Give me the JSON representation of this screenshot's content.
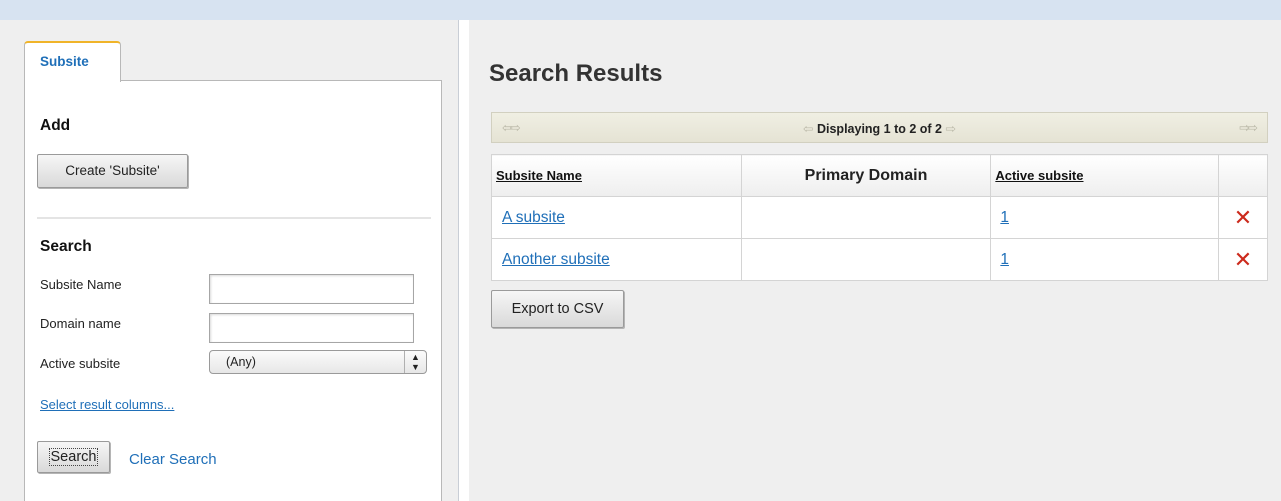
{
  "left": {
    "tab_label": "Subsite",
    "add_title": "Add",
    "create_button": "Create 'Subsite'",
    "search_title": "Search",
    "fields": [
      {
        "label": "Subsite Name",
        "value": ""
      },
      {
        "label": "Domain name",
        "value": ""
      },
      {
        "label": "Active subsite",
        "value": "(Any)"
      }
    ],
    "select_columns_link": "Select result columns...",
    "search_button": "Search",
    "clear_search_link": "Clear Search"
  },
  "results": {
    "title": "Search Results",
    "pager_text": "Displaying 1 to 2 of 2",
    "columns": [
      "Subsite Name",
      "Primary Domain",
      "Active subsite"
    ],
    "rows": [
      {
        "name": "A subsite",
        "domain": "",
        "active": "1"
      },
      {
        "name": "Another subsite",
        "domain": "",
        "active": "1"
      }
    ],
    "delete_symbol": "✕",
    "export_button": "Export to CSV"
  },
  "colors": {
    "link": "#1f6fb8",
    "tab_accent": "#f0b429",
    "delete_icon": "#cc2a1c",
    "top_strip": "#d7e3f1"
  }
}
